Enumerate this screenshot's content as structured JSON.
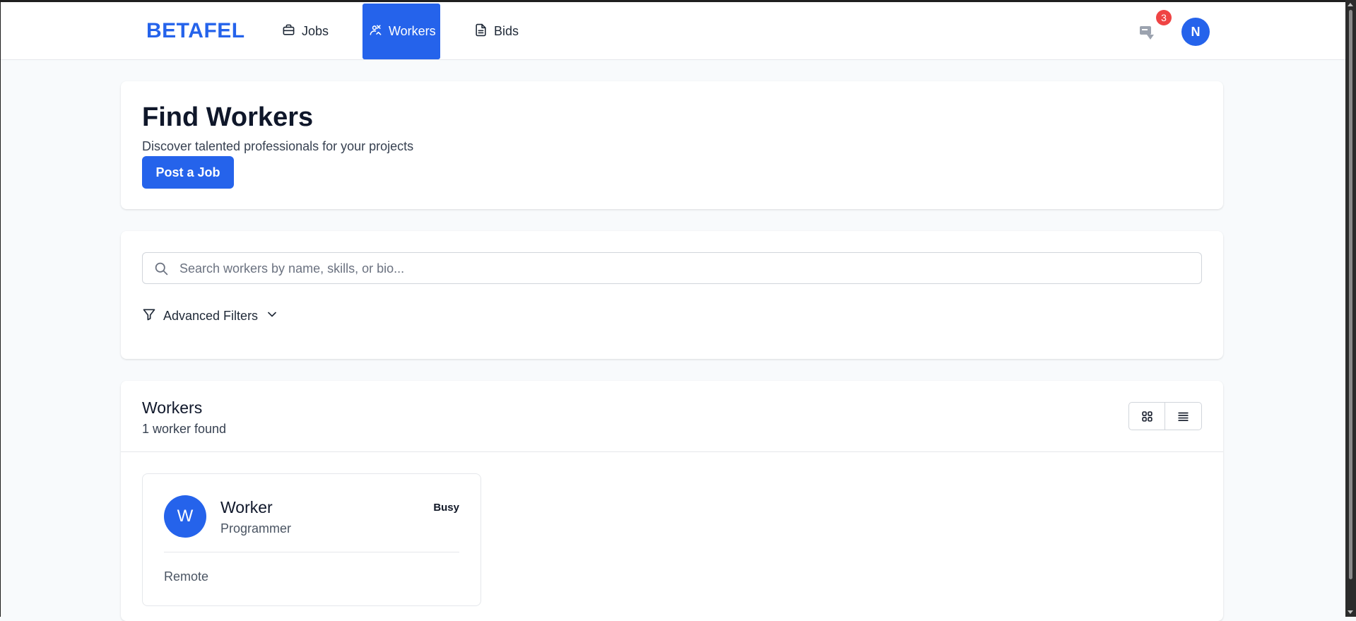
{
  "brand": {
    "logo_text": "BETAFEL",
    "accent_color": "#2563eb"
  },
  "nav": {
    "items": [
      {
        "label": "Jobs",
        "icon": "briefcase-icon",
        "active": false
      },
      {
        "label": "Workers",
        "icon": "worker-icon",
        "active": true
      },
      {
        "label": "Bids",
        "icon": "document-icon",
        "active": false
      }
    ],
    "notifications": {
      "icon": "message-icon",
      "count": "3"
    },
    "user": {
      "avatar_initial": "N"
    }
  },
  "hero": {
    "title": "Find Workers",
    "subtitle": "Discover talented professionals for your projects",
    "post_job_label": "Post a Job"
  },
  "search": {
    "placeholder": "Search workers by name, skills, or bio...",
    "value": "",
    "advanced_filters_label": "Advanced Filters"
  },
  "workers": {
    "title": "Workers",
    "count_text": "1 worker found",
    "view_modes": [
      "grid-icon",
      "list-icon"
    ],
    "list": [
      {
        "avatar_initial": "W",
        "name": "Worker",
        "role": "Programmer",
        "status": "Busy",
        "location": "Remote"
      }
    ]
  }
}
